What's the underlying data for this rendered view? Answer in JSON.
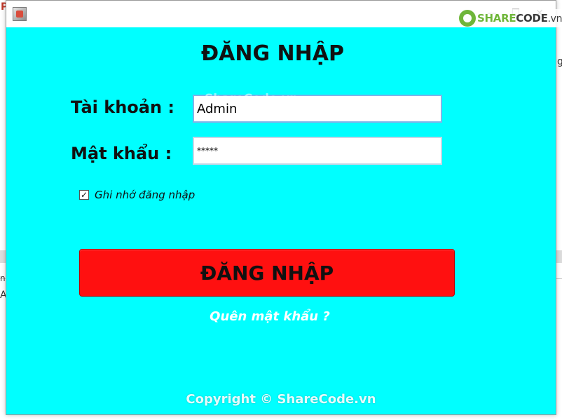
{
  "background": {
    "frag_top_left": "P",
    "frag_right_1": "g",
    "frag_left_1": "ns",
    "frag_left_2": "A"
  },
  "window": {
    "icon": "java-app-icon",
    "controls": [
      "minimize-icon",
      "maximize-icon",
      "close-icon"
    ]
  },
  "watermark": {
    "logo_text_a": "SHARE",
    "logo_text_b": "CODE",
    "logo_text_tld": ".vn",
    "overlay_text": "ShareCode.vn",
    "copyright": "Copyright © ShareCode.vn"
  },
  "form": {
    "title": "ĐĂNG NHẬP",
    "username_label": "Tài khoản :",
    "username_value": "Admin",
    "password_label": "Mật khẩu :",
    "password_value": "*****",
    "remember_label": "Ghi nhớ đăng nhập",
    "remember_checked": true,
    "login_button": "ĐĂNG NHẬP",
    "forgot_link": "Quên mật khẩu ?"
  },
  "colors": {
    "content_bg": "#00ffff",
    "button_bg": "#ff1010",
    "link": "#ffffff"
  }
}
